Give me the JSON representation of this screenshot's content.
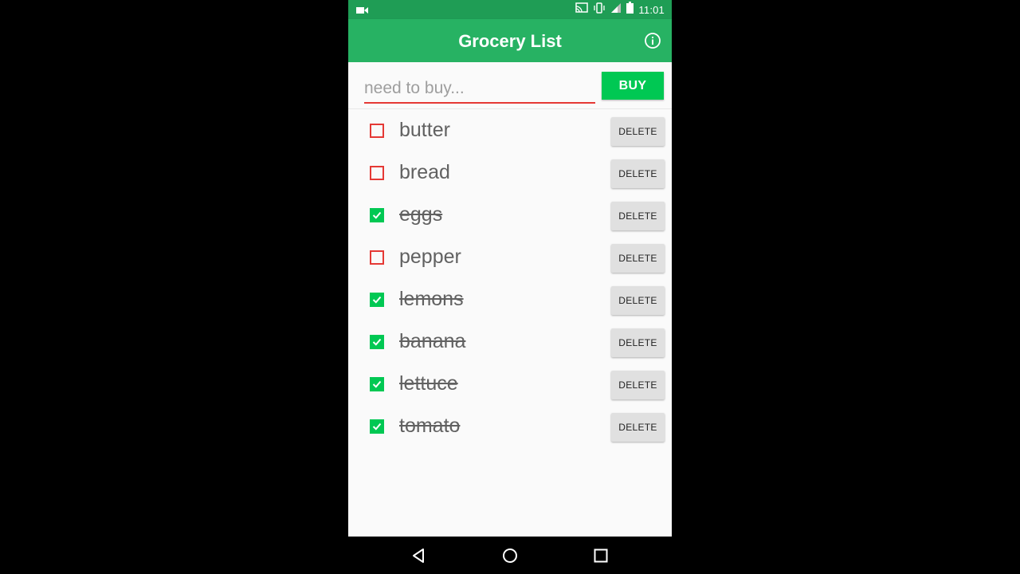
{
  "status_bar": {
    "time": "11:01"
  },
  "app_bar": {
    "title": "Grocery List"
  },
  "input": {
    "placeholder": "need to buy...",
    "value": ""
  },
  "buy_button": {
    "label": "BUY"
  },
  "items": [
    {
      "name": "butter",
      "checked": false,
      "delete_label": "DELETE"
    },
    {
      "name": "bread",
      "checked": false,
      "delete_label": "DELETE"
    },
    {
      "name": "eggs",
      "checked": true,
      "delete_label": "DELETE"
    },
    {
      "name": "pepper",
      "checked": false,
      "delete_label": "DELETE"
    },
    {
      "name": "lemons",
      "checked": true,
      "delete_label": "DELETE"
    },
    {
      "name": "banana",
      "checked": true,
      "delete_label": "DELETE"
    },
    {
      "name": "lettuce",
      "checked": true,
      "delete_label": "DELETE"
    },
    {
      "name": "tomato",
      "checked": true,
      "delete_label": "DELETE"
    }
  ],
  "colors": {
    "status_bar": "#1f9d55",
    "app_bar": "#27b263",
    "accent_green": "#00c853",
    "unchecked_red": "#e53935"
  },
  "icons": {
    "status_left": "video-camera-icon",
    "status_right": [
      "cast-icon",
      "vibrate-icon",
      "signal-icon",
      "battery-icon"
    ],
    "app_bar_action": "info-icon",
    "nav": [
      "back-icon",
      "home-icon",
      "recents-icon"
    ]
  }
}
